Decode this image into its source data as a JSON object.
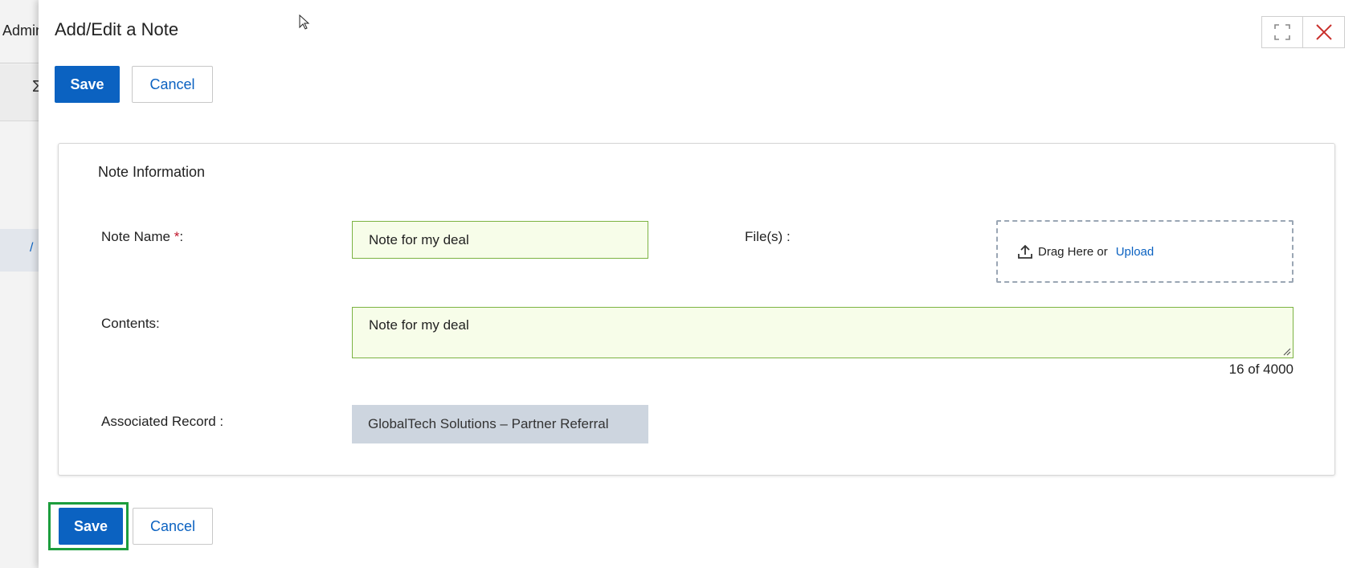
{
  "background": {
    "tab_label": "Admin",
    "toolbar_glyph": "Σ",
    "selected_glyph": "/"
  },
  "modal": {
    "title": "Add/Edit a Note",
    "icons": {
      "expand": "expand-icon",
      "close": "close-icon",
      "upload": "upload-icon"
    },
    "top_actions": {
      "save": "Save",
      "cancel": "Cancel"
    },
    "bottom_actions": {
      "save": "Save",
      "cancel": "Cancel"
    },
    "section": {
      "title": "Note Information",
      "note_name": {
        "label": "Note Name ",
        "required": "*",
        "suffix": ":",
        "value": "Note for my deal"
      },
      "files": {
        "label": "File(s) :",
        "drag_text": "Drag Here or",
        "upload_link": "Upload"
      },
      "contents": {
        "label": "Contents:",
        "value": "Note for my deal",
        "char_count": "16 of 4000"
      },
      "associated_record": {
        "label": "Associated Record :",
        "value": "GlobalTech Solutions – Partner Referral"
      }
    }
  },
  "colors": {
    "primary": "#0b62c1",
    "input_bg": "#f7fde9",
    "input_border": "#7cb342",
    "readonly_bg": "#cdd5df",
    "highlight": "#1c9d3d",
    "close_icon": "#c9302c"
  }
}
